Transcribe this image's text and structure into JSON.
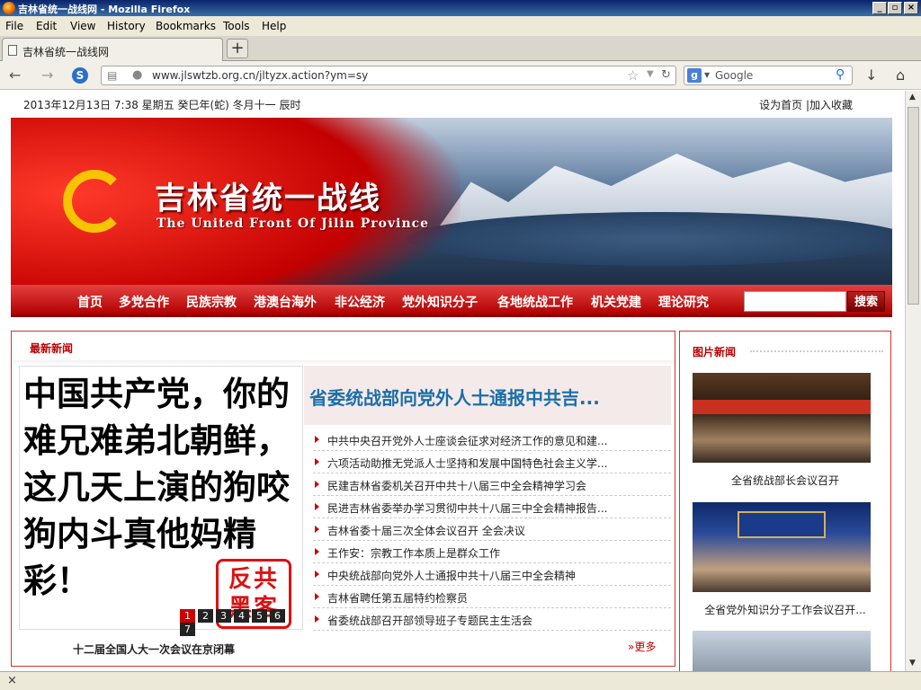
{
  "window": {
    "title": "吉林省统一战线网 - Mozilla Firefox",
    "controls": [
      "_",
      "▫",
      "×"
    ]
  },
  "menu": [
    "File",
    "Edit",
    "View",
    "History",
    "Bookmarks",
    "Tools",
    "Help"
  ],
  "tab": {
    "label": "吉林省统一战线网",
    "new_tab": "+"
  },
  "nav": {
    "url": "www.jlswtzb.org.cn/jltyzx.action?ym=sy",
    "search_placeholder": "Google",
    "search_engine_letter": "g"
  },
  "page": {
    "date": "2013年12月13日 7:38  星期五  癸巳年(蛇) 冬月十一  辰时",
    "toplinks": "设为首页 |加入收藏",
    "banner": {
      "title": "吉林省统一战线",
      "subtitle": "The United Front Of Jilin Province"
    },
    "navitems": [
      "首页",
      "多党合作",
      "民族宗教",
      "港澳台海外",
      "非公经济",
      "党外知识分子",
      "各地统战工作",
      "机关党建",
      "理论研究"
    ],
    "search_button": "搜索",
    "news": {
      "header": "最新新闻",
      "slide_text": "中国共产党，你的难兄难弟北朝鲜，这几天上演的狗咬狗内斗真他妈精彩！",
      "stamp": "反共黑客",
      "pages": [
        "1",
        "2",
        "3",
        "4",
        "5",
        "6",
        "7"
      ],
      "slide_caption": "十二届全国人大一次会议在京闭幕",
      "headline": "省委统战部向党外人士通报中共吉...",
      "items": [
        "中共中央召开党外人士座谈会征求对经济工作的意见和建...",
        "六项活动助推无党派人士坚持和发展中国特色社会主义学...",
        "民建吉林省委机关召开中共十八届三中全会精神学习会",
        "民进吉林省委举办学习贯彻中共十八届三中全会精神报告...",
        "吉林省委十届三次全体会议召开   全会决议",
        "王作安：宗教工作本质上是群众工作",
        "中央统战部向党外人士通报中共十八届三中全会精神",
        "吉林省聘任第五届特约检察员",
        "省委统战部召开部领导班子专题民主生活会"
      ],
      "more": "更多"
    },
    "photos": {
      "header": "图片新闻",
      "items": [
        "全省统战部长会议召开",
        "全省党外知识分子工作会议召开..."
      ]
    }
  },
  "status": {
    "close": "×"
  }
}
